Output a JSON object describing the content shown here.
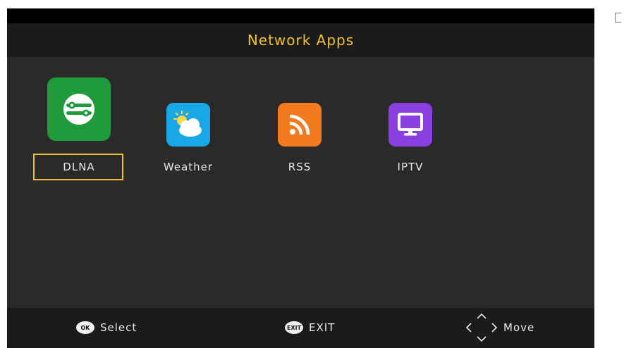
{
  "header": {
    "title": "Network Apps"
  },
  "apps": [
    {
      "label": "DLNA",
      "icon": "dlna-share-icon",
      "color": "#1f9b3c",
      "focused": true
    },
    {
      "label": "Weather",
      "icon": "sun-cloud-icon",
      "color": "#1aa7e8",
      "focused": false
    },
    {
      "label": "RSS",
      "icon": "rss-icon",
      "color": "#f47a1f",
      "focused": false
    },
    {
      "label": "IPTV",
      "icon": "tv-monitor-icon",
      "color": "#8a3fe0",
      "focused": false
    }
  ],
  "footer": {
    "select": {
      "key": "OK",
      "label": "Select"
    },
    "exit": {
      "key": "EXIT",
      "label": "EXIT"
    },
    "move": {
      "key_icon": "dpad-arrows-icon",
      "label": "Move"
    }
  },
  "colors": {
    "accent": "#f2c22e",
    "background": "#2a2a2a",
    "bar": "#1b1b1b"
  }
}
